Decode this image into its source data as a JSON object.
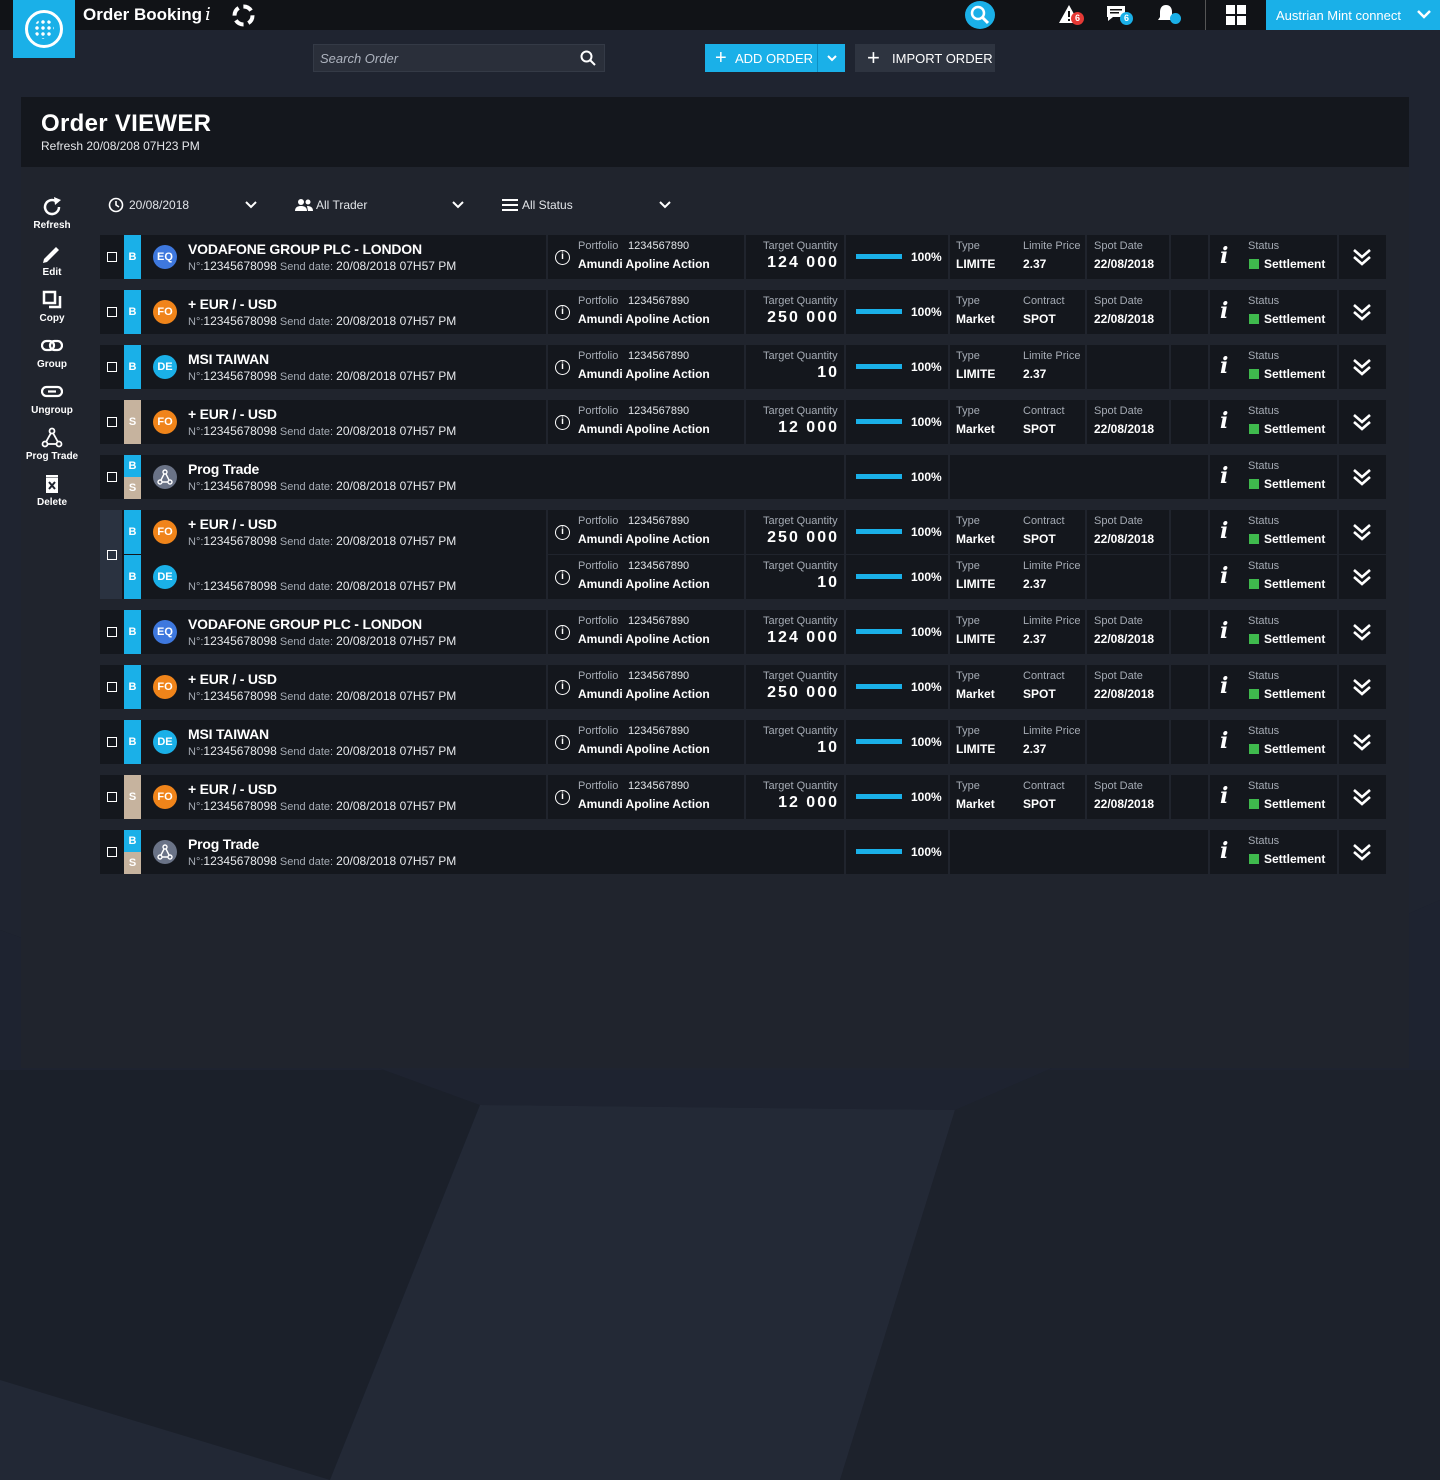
{
  "app": {
    "title": "Order Booking",
    "info": "i",
    "account": "Austrian Mint connect"
  },
  "colors": {
    "accent": "#1ab0e8",
    "bg": "#1f2430",
    "panel": "#20242d",
    "row": "#14171d",
    "status_ok": "#3fba4d",
    "badge_red": "#e53935"
  },
  "notifications": {
    "alerts": "6",
    "messages": "6"
  },
  "search": {
    "placeholder": "Search Order"
  },
  "buttons": {
    "add_order": "ADD ORDER",
    "import_order": "IMPORT ORDER"
  },
  "panel": {
    "title": "Order VIEWER",
    "subtitle": "Refresh 20/08/208 07H23 PM"
  },
  "tools": [
    {
      "label": "Refresh",
      "icon": "refresh-icon"
    },
    {
      "label": "Edit",
      "icon": "pencil-icon"
    },
    {
      "label": "Copy",
      "icon": "copy-icon"
    },
    {
      "label": "Group",
      "icon": "link-icon"
    },
    {
      "label": "Ungroup",
      "icon": "unlink-icon"
    },
    {
      "label": "Prog Trade",
      "icon": "nodes-icon"
    },
    {
      "label": "Delete",
      "icon": "trash-icon"
    }
  ],
  "filters": {
    "date": "20/08/2018",
    "trader": "All Trader",
    "status": "All Status"
  },
  "common": {
    "no_prefix": "N°:",
    "send_label": "Send date:",
    "portfolio_label": "Portfolio",
    "target_label": "Target Quantity",
    "type_label": "Type",
    "spot_label": "Spot Date",
    "status_label": "Status",
    "info": "i"
  },
  "orders": [
    {
      "side": "B",
      "class": "EQ",
      "name": "VODAFONE GROUP PLC - LONDON",
      "no": "12345678098",
      "send": "20/08/2018 07H57 PM",
      "portfolio_no": "1234567890",
      "portfolio": "Amundi Apoline Action",
      "qty": "124 000",
      "progress": "100%",
      "type": "LIMITE",
      "k2": "Limite Price",
      "v2": "2.37",
      "spot": "22/08/2018",
      "status": "Settlement"
    },
    {
      "side": "B",
      "class": "FO",
      "name": "+ EUR / - USD",
      "no": "12345678098",
      "send": "20/08/2018 07H57 PM",
      "portfolio_no": "1234567890",
      "portfolio": "Amundi Apoline Action",
      "qty": "250 000",
      "progress": "100%",
      "type": "Market",
      "k2": "Contract",
      "v2": "SPOT",
      "spot": "22/08/2018",
      "status": "Settlement"
    },
    {
      "side": "B",
      "class": "DE",
      "name": "MSI TAIWAN",
      "no": "12345678098",
      "send": "20/08/2018 07H57 PM",
      "portfolio_no": "1234567890",
      "portfolio": "Amundi Apoline Action",
      "qty": "10",
      "progress": "100%",
      "type": "LIMITE",
      "k2": "Limite Price",
      "v2": "2.37",
      "spot": "",
      "status": "Settlement"
    },
    {
      "side": "S",
      "class": "FO",
      "name": "+ EUR / - USD",
      "no": "12345678098",
      "send": "20/08/2018 07H57 PM",
      "portfolio_no": "1234567890",
      "portfolio": "Amundi Apoline Action",
      "qty": "12 000",
      "progress": "100%",
      "type": "Market",
      "k2": "Contract",
      "v2": "SPOT",
      "spot": "22/08/2018",
      "status": "Settlement"
    },
    {
      "side": "BS",
      "class": "PG",
      "name": "Prog Trade",
      "no": "12345678098",
      "send": "20/08/2018 07H57 PM",
      "progress": "100%",
      "status": "Settlement"
    },
    {
      "group": true,
      "subs": [
        {
          "side": "B",
          "class": "FO",
          "name": "+ EUR / - USD",
          "no": "12345678098",
          "send": "20/08/2018 07H57 PM",
          "portfolio_no": "1234567890",
          "portfolio": "Amundi Apoline Action",
          "qty": "250 000",
          "progress": "100%",
          "type": "Market",
          "k2": "Contract",
          "v2": "SPOT",
          "spot": "22/08/2018",
          "status": "Settlement"
        },
        {
          "side": "B",
          "class": "DE",
          "name": "",
          "no": "12345678098",
          "send": "20/08/2018 07H57 PM",
          "portfolio_no": "1234567890",
          "portfolio": "Amundi Apoline Action",
          "qty": "10",
          "progress": "100%",
          "type": "LIMITE",
          "k2": "Limite Price",
          "v2": "2.37",
          "spot": "",
          "status": "Settlement"
        }
      ]
    },
    {
      "side": "B",
      "class": "EQ",
      "name": "VODAFONE GROUP PLC - LONDON",
      "no": "12345678098",
      "send": "20/08/2018 07H57 PM",
      "portfolio_no": "1234567890",
      "portfolio": "Amundi Apoline Action",
      "qty": "124 000",
      "progress": "100%",
      "type": "LIMITE",
      "k2": "Limite Price",
      "v2": "2.37",
      "spot": "22/08/2018",
      "status": "Settlement"
    },
    {
      "side": "B",
      "class": "FO",
      "name": "+ EUR / - USD",
      "no": "12345678098",
      "send": "20/08/2018 07H57 PM",
      "portfolio_no": "1234567890",
      "portfolio": "Amundi Apoline Action",
      "qty": "250 000",
      "progress": "100%",
      "type": "Market",
      "k2": "Contract",
      "v2": "SPOT",
      "spot": "22/08/2018",
      "status": "Settlement"
    },
    {
      "side": "B",
      "class": "DE",
      "name": "MSI TAIWAN",
      "no": "12345678098",
      "send": "20/08/2018 07H57 PM",
      "portfolio_no": "1234567890",
      "portfolio": "Amundi Apoline Action",
      "qty": "10",
      "progress": "100%",
      "type": "LIMITE",
      "k2": "Limite Price",
      "v2": "2.37",
      "spot": "",
      "status": "Settlement"
    },
    {
      "side": "S",
      "class": "FO",
      "name": "+ EUR / - USD",
      "no": "12345678098",
      "send": "20/08/2018 07H57 PM",
      "portfolio_no": "1234567890",
      "portfolio": "Amundi Apoline Action",
      "qty": "12 000",
      "progress": "100%",
      "type": "Market",
      "k2": "Contract",
      "v2": "SPOT",
      "spot": "22/08/2018",
      "status": "Settlement"
    },
    {
      "side": "BS",
      "class": "PG",
      "name": "Prog Trade",
      "no": "12345678098",
      "send": "20/08/2018 07H57 PM",
      "progress": "100%",
      "status": "Settlement"
    }
  ]
}
